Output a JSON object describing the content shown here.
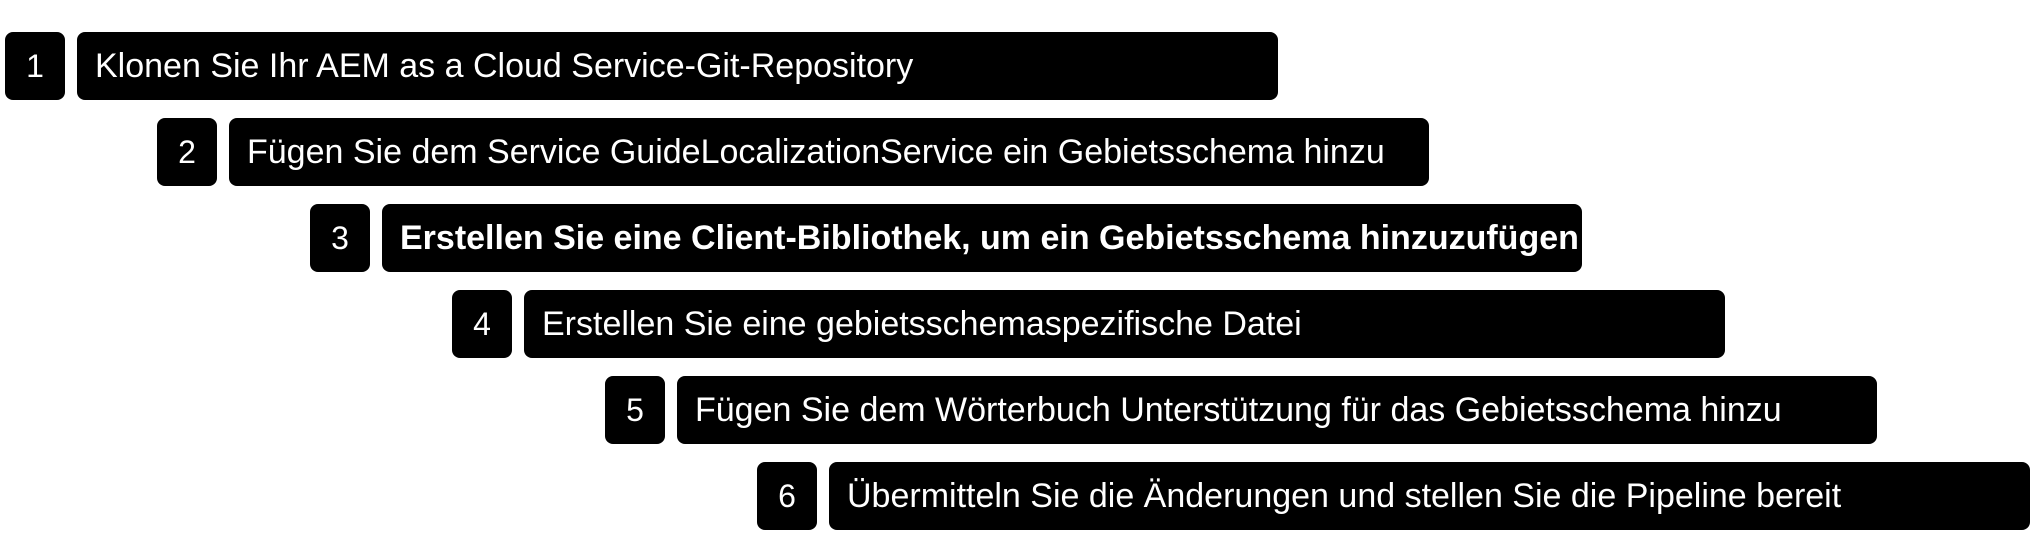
{
  "steps": [
    {
      "number": "1",
      "label": "Klonen Sie Ihr AEM as a Cloud Service-Git-Repository"
    },
    {
      "number": "2",
      "label": "Fügen Sie dem Service GuideLocalizationService ein Gebietsschema hinzu"
    },
    {
      "number": "3",
      "label": "Erstellen Sie eine Client-Bibliothek, um ein Gebietsschema hinzuzufügen"
    },
    {
      "number": "4",
      "label": "Erstellen Sie eine gebietsschemaspezifische Datei"
    },
    {
      "number": "5",
      "label": "Fügen Sie dem Wörterbuch Unterstützung für das Gebietsschema hinzu"
    },
    {
      "number": "6",
      "label": "Übermitteln Sie die Änderungen und stellen Sie die Pipeline bereit"
    }
  ],
  "active_step": "3",
  "colors": {
    "box": "#000000",
    "text": "#ffffff",
    "background": "#ffffff"
  }
}
